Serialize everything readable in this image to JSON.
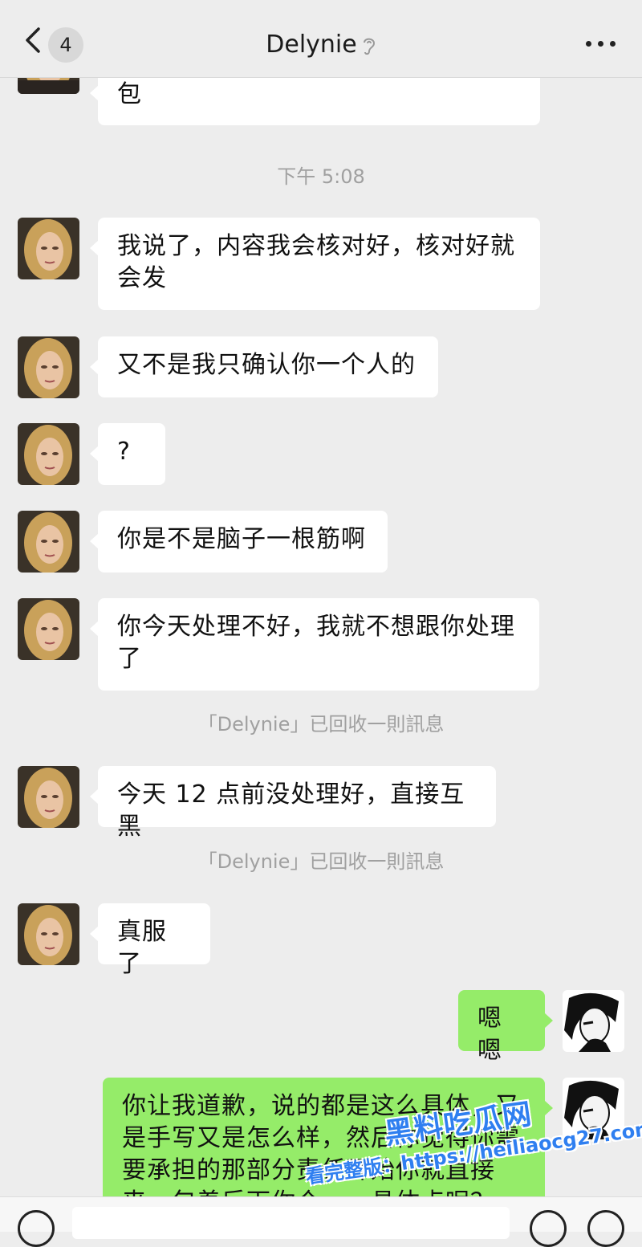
{
  "header": {
    "unread_count": "4",
    "title": "Delynie",
    "icons": {
      "back": "chevron-left-icon",
      "earpiece": "ear-icon",
      "more": "more-dots-icon"
    }
  },
  "messages": [
    {
      "side": "in",
      "text": "包"
    },
    {
      "type": "time",
      "text": "下午 5:08"
    },
    {
      "side": "in",
      "text": "我说了，内容我会核对好，核对好就会发"
    },
    {
      "side": "in",
      "text": "又不是我只确认你一个人的"
    },
    {
      "side": "in",
      "text": "?"
    },
    {
      "side": "in",
      "text": "你是不是脑子一根筋啊"
    },
    {
      "side": "in",
      "text": "你今天处理不好，我就不想跟你处理了"
    },
    {
      "type": "system",
      "text": "「Delynie」已回收一則訊息"
    },
    {
      "side": "in",
      "text": "今天 12 点前没处理好，直接互黑"
    },
    {
      "type": "system",
      "text": "「Delynie」已回收一則訊息"
    },
    {
      "side": "in",
      "text": "真服了"
    },
    {
      "side": "out",
      "text": "嗯嗯"
    },
    {
      "side": "out",
      "text": "你让我道歉，说的都是这么具体，又是手写又是怎么样，然后你觉得你需要承担的那部分责任开始你就直接来，包着后下你个……具体点呢？"
    }
  ],
  "watermark": {
    "main": "黑料吃瓜网",
    "sub": "看完整版：https://heiliaocg27.com"
  },
  "colors": {
    "background": "#ededed",
    "incoming_bubble": "#ffffff",
    "outgoing_bubble": "#95ec69",
    "system_text": "#a0a0a0"
  }
}
